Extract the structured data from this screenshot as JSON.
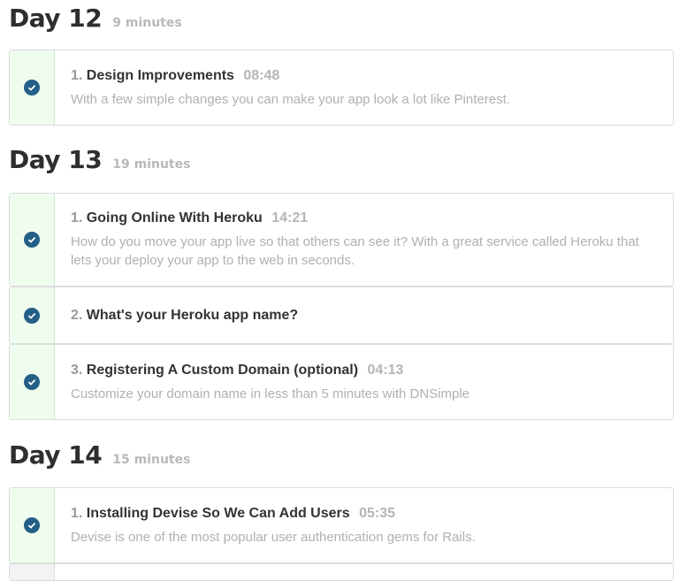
{
  "days": [
    {
      "title": "Day 12",
      "duration": "9 minutes",
      "lessons": [
        {
          "number": "1.",
          "title": "Design Improvements",
          "time": "08:48",
          "description": "With a few simple changes you can make your app look a lot like Pinterest.",
          "completed": true
        }
      ]
    },
    {
      "title": "Day 13",
      "duration": "19 minutes",
      "lessons": [
        {
          "number": "1.",
          "title": "Going Online With Heroku",
          "time": "14:21",
          "description": "How do you move your app live so that others can see it? With a great service called Heroku that lets your deploy your app to the web in seconds.",
          "completed": true
        },
        {
          "number": "2.",
          "title": "What's your Heroku app name?",
          "time": "",
          "description": "",
          "completed": true
        },
        {
          "number": "3.",
          "title": "Registering A Custom Domain (optional)",
          "time": "04:13",
          "description": "Customize your domain name in less than 5 minutes with DNSimple",
          "completed": true
        }
      ]
    },
    {
      "title": "Day 14",
      "duration": "15 minutes",
      "lessons": [
        {
          "number": "1.",
          "title": "Installing Devise So We Can Add Users",
          "time": "05:35",
          "description": "Devise is one of the most popular user authentication gems for Rails.",
          "completed": true
        }
      ]
    }
  ],
  "colors": {
    "check": "#235f86",
    "status_bg": "#effdef"
  }
}
